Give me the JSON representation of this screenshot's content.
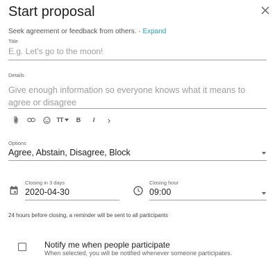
{
  "dialog": {
    "title": "Start proposal",
    "subtitle": "Seek agreement or feedback from others. · ",
    "expand_label": "Expand",
    "close_icon": "close-icon"
  },
  "title_field": {
    "label": "Title",
    "placeholder": "E.g. Let's go to the moon!"
  },
  "details_field": {
    "label": "Details",
    "placeholder": "Give enough information so everyone knows what it means to agree or disagree"
  },
  "toolbar": {
    "items": [
      "attachment-icon",
      "link-icon",
      "emoji-icon",
      "text-size-icon",
      "bold-icon",
      "italic-icon",
      "more-icon"
    ],
    "text_size_label": "TT",
    "bold_label": "B",
    "italic_label": "I",
    "more_label": "›"
  },
  "options_field": {
    "label": "Options",
    "value": "Agree, Abstain, Disagree, Block"
  },
  "closing_date": {
    "label": "Closing in 3 days",
    "value": "2020-04-30"
  },
  "closing_hour": {
    "label": "Closing hour",
    "value": "09:00"
  },
  "reminder_note": "24 hours before closing, a reminder will be sent to all participants",
  "notify": {
    "checked": false,
    "title": "Notify me when people participate",
    "subtitle": "When selected, you will be notified whenever someone participates."
  }
}
